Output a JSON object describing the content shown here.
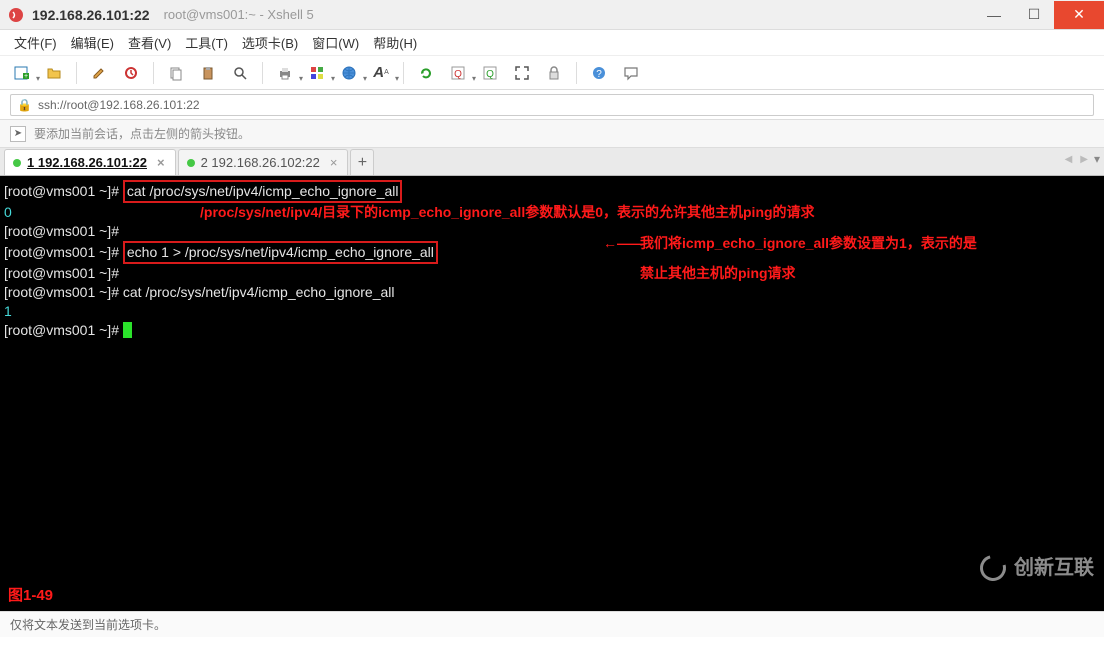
{
  "titlebar": {
    "address": "192.168.26.101:22",
    "subtitle": "root@vms001:~ - Xshell 5"
  },
  "win_controls": {
    "min": "—",
    "max": "☐",
    "close": "✕"
  },
  "menu": {
    "file": "文件(F)",
    "edit": "编辑(E)",
    "view": "查看(V)",
    "tools": "工具(T)",
    "tab": "选项卡(B)",
    "window": "窗口(W)",
    "help": "帮助(H)"
  },
  "toolbar_icons": {
    "new": "new-session-icon",
    "open": "open-icon",
    "prop": "properties-icon",
    "copy": "copy-icon",
    "paste": "paste-icon",
    "find": "find-icon",
    "print": "print-icon",
    "color": "color-icon",
    "globe": "globe-icon",
    "font": "font-icon",
    "refresh": "refresh-icon",
    "q1": "q-icon",
    "q2": "q-icon-2",
    "full": "fullscreen-icon",
    "lock": "lock-icon",
    "help": "help-icon",
    "chat": "chat-icon"
  },
  "addressbar": {
    "url": "ssh://root@192.168.26.101:22"
  },
  "infobar": {
    "tip": "要添加当前会话，点击左侧的箭头按钮。"
  },
  "tabs": [
    {
      "label": "1 192.168.26.101:22",
      "active": true
    },
    {
      "label": "2 192.168.26.102:22",
      "active": false
    }
  ],
  "tab_new": "+",
  "terminal": {
    "prompt_host": "[root@vms001 ~]#",
    "cmd1": "cat /proc/sys/net/ipv4/icmp_echo_ignore_all",
    "out1": "0",
    "cmd2": "echo 1 > /proc/sys/net/ipv4/icmp_echo_ignore_all",
    "cmd3": "cat /proc/sys/net/ipv4/icmp_echo_ignore_all",
    "out3": "1",
    "figure_label": "图1-49"
  },
  "annotations": {
    "line1": "/proc/sys/net/ipv4/目录下的icmp_echo_ignore_all参数默认是0，表示的允许其他主机ping的请求",
    "line2a": "我们将icmp_echo_ignore_all参数设置为1，表示的是",
    "line2b": "禁止其他主机的ping请求",
    "arrow": "←——"
  },
  "statusbar": {
    "text": "仅将文本发送到当前选项卡。"
  },
  "watermark": {
    "text": "创新互联"
  }
}
